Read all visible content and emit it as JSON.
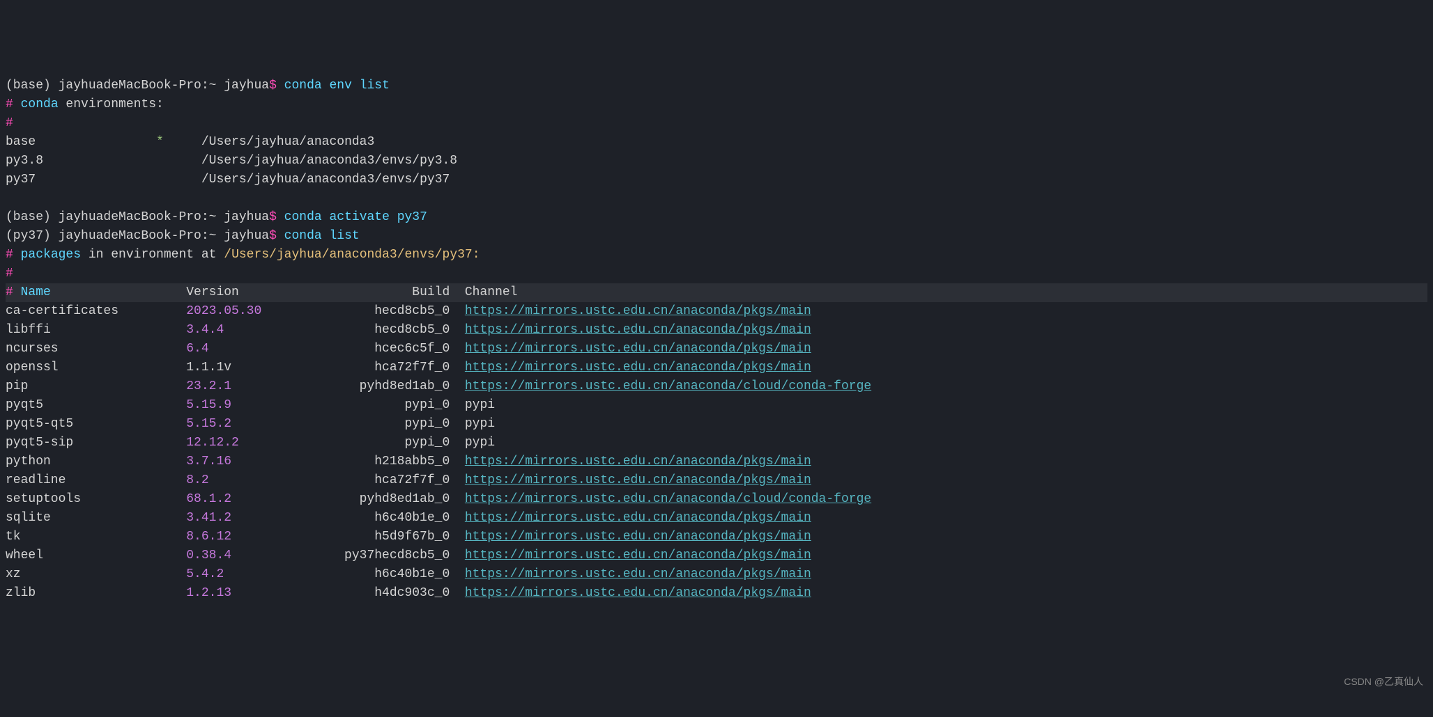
{
  "prompt1": {
    "env": "(base)",
    "host": " jayhuadeMacBook-Pro:~ jayhua",
    "dollar": "$",
    "cmd": " conda env list"
  },
  "env_header": {
    "hash": "#",
    "label": " conda",
    "rest": " environments:"
  },
  "hash_line": "#",
  "envs": [
    {
      "name": "base",
      "active": "*",
      "path": "  /Users/jayhua/anaconda3"
    },
    {
      "name": "py3.8",
      "active": " ",
      "path": "  /Users/jayhua/anaconda3/envs/py3.8"
    },
    {
      "name": "py37",
      "active": " ",
      "path": "  /Users/jayhua/anaconda3/envs/py37"
    }
  ],
  "blank": " ",
  "prompt2": {
    "env": "(base)",
    "host": " jayhuadeMacBook-Pro:~ jayhua",
    "dollar": "$",
    "cmd": " conda activate py37"
  },
  "prompt3": {
    "env": "(py37)",
    "host": " jayhuadeMacBook-Pro:~ jayhua",
    "dollar": "$",
    "cmd": " conda list"
  },
  "pkg_header": {
    "hash": "#",
    "label": " packages",
    "mid": " in environment at ",
    "path": "/Users/jayhua/anaconda3/envs/py37:"
  },
  "table_header": {
    "hash": "#",
    "name": " Name",
    "version": "Version",
    "build": "Build",
    "channel": "Channel"
  },
  "packages": [
    {
      "name": "ca-certificates",
      "version": "2023.05.30",
      "build": "hecd8cb5_0",
      "channel": "https://mirrors.ustc.edu.cn/anaconda/pkgs/main",
      "link": true
    },
    {
      "name": "libffi",
      "version": "3.4.4",
      "build": "hecd8cb5_0",
      "channel": "https://mirrors.ustc.edu.cn/anaconda/pkgs/main",
      "link": true
    },
    {
      "name": "ncurses",
      "version": "6.4",
      "build": "hcec6c5f_0",
      "channel": "https://mirrors.ustc.edu.cn/anaconda/pkgs/main",
      "link": true
    },
    {
      "name": "openssl",
      "version": "1.1.1v",
      "build": "hca72f7f_0",
      "channel": "https://mirrors.ustc.edu.cn/anaconda/pkgs/main",
      "link": true,
      "vwhite": true
    },
    {
      "name": "pip",
      "version": "23.2.1",
      "build": "pyhd8ed1ab_0",
      "channel": "https://mirrors.ustc.edu.cn/anaconda/cloud/conda-forge",
      "link": true
    },
    {
      "name": "pyqt5",
      "version": "5.15.9",
      "build": "pypi_0",
      "channel": "pypi",
      "link": false
    },
    {
      "name": "pyqt5-qt5",
      "version": "5.15.2",
      "build": "pypi_0",
      "channel": "pypi",
      "link": false
    },
    {
      "name": "pyqt5-sip",
      "version": "12.12.2",
      "build": "pypi_0",
      "channel": "pypi",
      "link": false
    },
    {
      "name": "python",
      "version": "3.7.16",
      "build": "h218abb5_0",
      "channel": "https://mirrors.ustc.edu.cn/anaconda/pkgs/main",
      "link": true
    },
    {
      "name": "readline",
      "version": "8.2",
      "build": "hca72f7f_0",
      "channel": "https://mirrors.ustc.edu.cn/anaconda/pkgs/main",
      "link": true
    },
    {
      "name": "setuptools",
      "version": "68.1.2",
      "build": "pyhd8ed1ab_0",
      "channel": "https://mirrors.ustc.edu.cn/anaconda/cloud/conda-forge",
      "link": true
    },
    {
      "name": "sqlite",
      "version": "3.41.2",
      "build": "h6c40b1e_0",
      "channel": "https://mirrors.ustc.edu.cn/anaconda/pkgs/main",
      "link": true
    },
    {
      "name": "tk",
      "version": "8.6.12",
      "build": "h5d9f67b_0",
      "channel": "https://mirrors.ustc.edu.cn/anaconda/pkgs/main",
      "link": true
    },
    {
      "name": "wheel",
      "version": "0.38.4",
      "build": "py37hecd8cb5_0",
      "channel": "https://mirrors.ustc.edu.cn/anaconda/pkgs/main",
      "link": true
    },
    {
      "name": "xz",
      "version": "5.4.2",
      "build": "h6c40b1e_0",
      "channel": "https://mirrors.ustc.edu.cn/anaconda/pkgs/main",
      "link": true
    },
    {
      "name": "zlib",
      "version": "1.2.13",
      "build": "h4dc903c_0",
      "channel": "https://mirrors.ustc.edu.cn/anaconda/pkgs/main",
      "link": true
    }
  ],
  "watermark": "CSDN @乙真仙人"
}
